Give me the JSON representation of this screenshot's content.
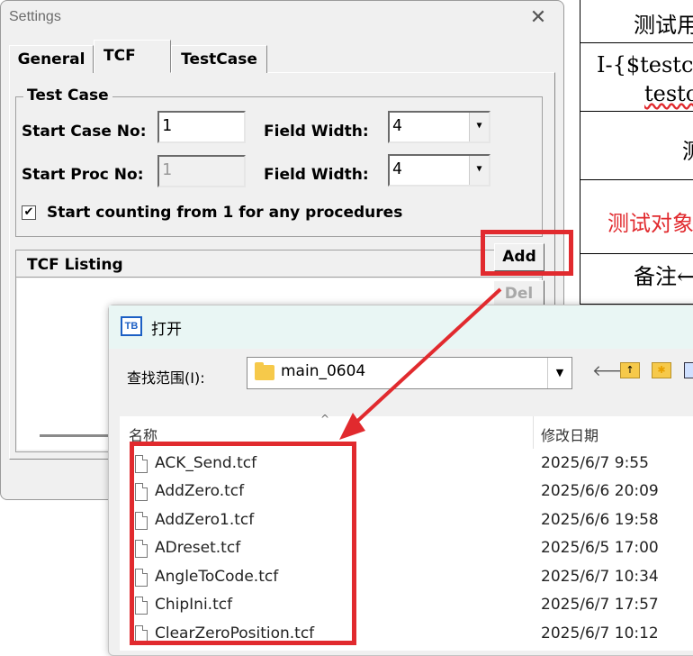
{
  "background_document": {
    "cells": [
      "测试用",
      "I-{$testca",
      "testc",
      "测",
      "测试对象",
      "备注←"
    ]
  },
  "settings": {
    "title": "Settings",
    "close_glyph": "✕",
    "tabs": [
      "General",
      "TCF",
      "TestCase"
    ],
    "test_case": {
      "group_label": "Test Case",
      "start_case_label": "Start Case No:",
      "start_case_value": "1",
      "start_proc_label": "Start Proc No:",
      "start_proc_value": "1",
      "field_width_label": "Field Width:",
      "field_width_1": "4",
      "field_width_2": "4",
      "checkbox_checked": true,
      "checkbox_mark": "✔",
      "checkbox_label": "Start counting from 1 for any procedures"
    },
    "tcf_listing": {
      "label": "TCF Listing",
      "add_button": "Add",
      "del_button": "Del"
    }
  },
  "open_dialog": {
    "icon_text": "TB",
    "title": "打开",
    "lookin_label": "查找范围(I):",
    "folder": "main_0604",
    "dropdown_glyph": "▼",
    "toolbar_icons": [
      "back-arrow-icon",
      "up-folder-icon",
      "new-folder-icon",
      "view-menu-icon"
    ],
    "columns": {
      "name": "名称",
      "date": "修改日期"
    },
    "sort_glyph": "^",
    "files": [
      {
        "name": "ACK_Send.tcf",
        "date": "2025/6/7 9:55"
      },
      {
        "name": "AddZero.tcf",
        "date": "2025/6/6 20:09"
      },
      {
        "name": "AddZero1.tcf",
        "date": "2025/6/6 19:58"
      },
      {
        "name": "ADreset.tcf",
        "date": "2025/6/5 17:00"
      },
      {
        "name": "AngleToCode.tcf",
        "date": "2025/6/7 10:34"
      },
      {
        "name": "ChipIni.tcf",
        "date": "2025/6/7 17:57"
      },
      {
        "name": "ClearZeroPosition.tcf",
        "date": "2025/6/7 10:12"
      }
    ]
  },
  "colors": {
    "highlight": "#e12a2e",
    "document_red_text": "#e12a2e"
  }
}
